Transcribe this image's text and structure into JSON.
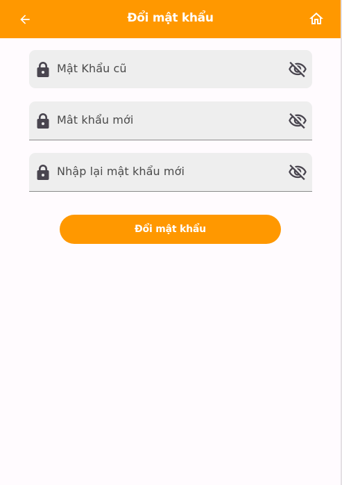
{
  "appbar": {
    "title": "Đổi mật khẩu",
    "back_icon": "arrow-left-icon",
    "home_icon": "home-icon",
    "color": "#ff9800"
  },
  "form": {
    "fields": [
      {
        "placeholder": "Mật Khẩu cũ",
        "lead_icon": "lock-icon",
        "trail_icon": "eye-off-icon"
      },
      {
        "placeholder": "Mât khẩu mới",
        "lead_icon": "lock-icon",
        "trail_icon": "eye-off-icon"
      },
      {
        "placeholder": "Nhập lại mật khẩu mới",
        "lead_icon": "lock-icon",
        "trail_icon": "eye-off-icon"
      }
    ],
    "submit_label": "Đổi mật khẩu"
  },
  "colors": {
    "accent": "#ff9800",
    "background": "#fffbfe",
    "field_bg": "#eeeeee",
    "icon": "#49454f"
  }
}
